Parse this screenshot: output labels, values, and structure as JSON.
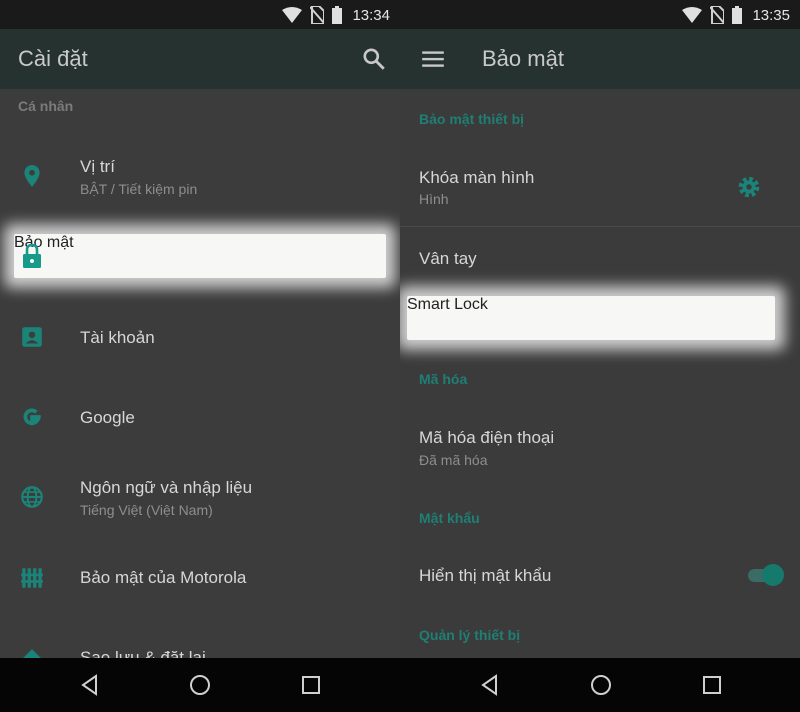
{
  "left": {
    "status": {
      "time": "13:34"
    },
    "appbar": {
      "title": "Cài đặt",
      "search_icon": "search-icon"
    },
    "section": "Cá nhân",
    "items": [
      {
        "title": "Vị trí",
        "subtitle": "BẬT / Tiết kiệm pin",
        "icon": "location-pin-icon"
      },
      {
        "title": "Bảo mật",
        "icon": "lock-icon",
        "highlighted": true
      },
      {
        "title": "Tài khoản",
        "icon": "account-box-icon"
      },
      {
        "title": "Google",
        "icon": "google-icon"
      },
      {
        "title": "Ngôn ngữ và nhập liệu",
        "subtitle": "Tiếng Việt (Việt Nam)",
        "icon": "globe-icon"
      },
      {
        "title": "Bảo mật của Motorola",
        "icon": "fence-icon"
      },
      {
        "title": "Sao lưu & đặt lại",
        "icon": "backup-icon"
      }
    ]
  },
  "right": {
    "status": {
      "time": "13:35"
    },
    "appbar": {
      "title": "Bảo mật",
      "menu_icon": "menu-icon"
    },
    "sections": [
      {
        "header": "Bảo mật thiết bị"
      },
      {
        "header": "Mã hóa"
      },
      {
        "header": "Mật khẩu"
      },
      {
        "header": "Quản lý thiết bị"
      }
    ],
    "items": [
      {
        "title": "Khóa màn hình",
        "subtitle": "Hình",
        "icon": "gear-icon"
      },
      {
        "title": "Vân tay"
      },
      {
        "title": "Smart Lock",
        "highlighted": true
      },
      {
        "title": "Mã hóa điện thoại",
        "subtitle": "Đã mã hóa"
      },
      {
        "title": "Hiển thị mật khẩu",
        "toggle": "on"
      }
    ]
  },
  "colors": {
    "accent": "#1f7f74",
    "appbar": "#263230",
    "background": "#3c3c3c",
    "highlight": "#f7f7f5"
  }
}
